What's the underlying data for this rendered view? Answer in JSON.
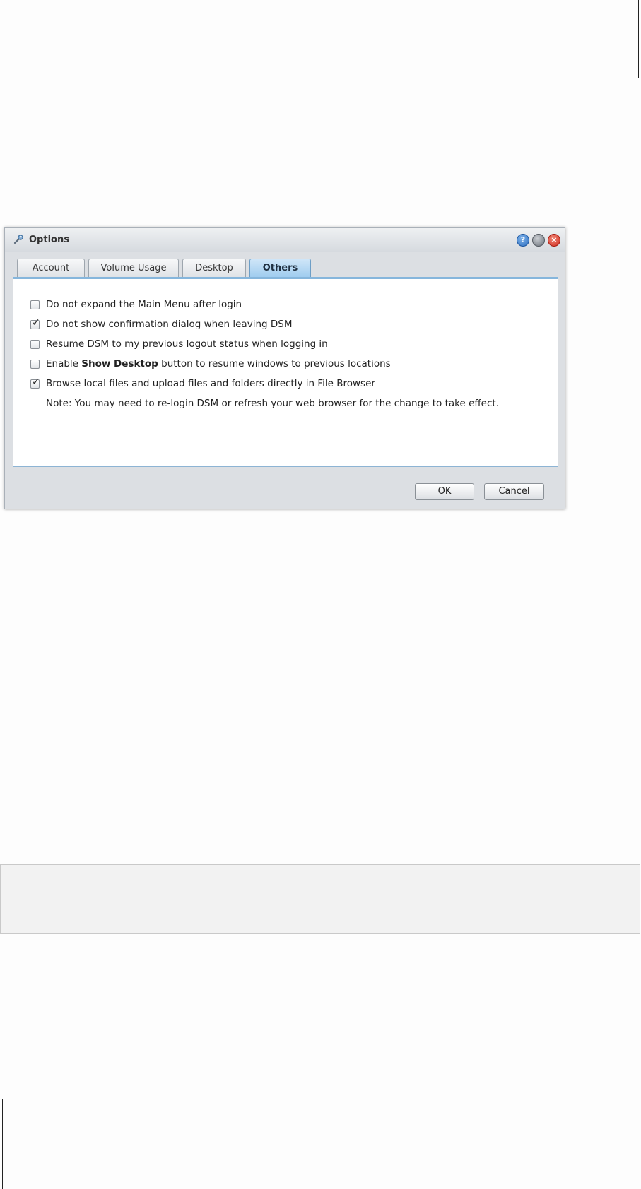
{
  "dialog": {
    "title": "Options",
    "title_icon": "options-wrench-icon",
    "titlebar_buttons": [
      {
        "name": "help",
        "glyph": "?"
      },
      {
        "name": "minimize",
        "glyph": ""
      },
      {
        "name": "close",
        "glyph": "×"
      }
    ],
    "tabs": [
      {
        "label": "Account",
        "active": false
      },
      {
        "label": "Volume Usage",
        "active": false
      },
      {
        "label": "Desktop",
        "active": false
      },
      {
        "label": "Others",
        "active": true
      }
    ],
    "options": [
      {
        "prefix": "Do not expand the Main Menu after login",
        "bold": "",
        "suffix": "",
        "checked": false
      },
      {
        "prefix": "Do not show confirmation dialog when leaving DSM",
        "bold": "",
        "suffix": "",
        "checked": true
      },
      {
        "prefix": "Resume DSM to my previous logout status when logging in",
        "bold": "",
        "suffix": "",
        "checked": false
      },
      {
        "prefix": "Enable ",
        "bold": "Show Desktop",
        "suffix": " button to resume windows to previous locations",
        "checked": false
      },
      {
        "prefix": "Browse local files and upload files and folders directly in File Browser",
        "bold": "",
        "suffix": "",
        "checked": true
      }
    ],
    "note": "Note: You may need to re-login DSM or refresh your web browser for the change to take effect.",
    "ok_label": "OK",
    "cancel_label": "Cancel",
    "colors": {
      "active_tab": "#9ccaee",
      "panel_border": "#86b6dc",
      "help_button": "#2d6fc0",
      "close_button": "#cf2b1d"
    }
  }
}
